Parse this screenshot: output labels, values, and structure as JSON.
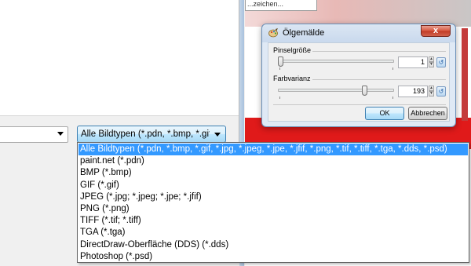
{
  "file_dialog": {
    "filename_value": "",
    "filetype_selected": "Alle Bildtypen (*.pdn, *.bmp, *.gif, *.jpg, *.jpeg, *.jpe, *.jfif, *.png, *.tif, *.tiff, *.tga, *.dds, *.psd)",
    "filetype_options": [
      "Alle Bildtypen (*.pdn, *.bmp, *.gif, *.jpg, *.jpeg, *.jpe, *.jfif, *.png, *.tif, *.tiff, *.tga, *.dds, *.psd)",
      "paint.net (*.pdn)",
      "BMP (*.bmp)",
      "GIF (*.gif)",
      "JPEG (*.jpg; *.jpeg; *.jpe; *.jfif)",
      "PNG (*.png)",
      "TIFF (*.tif; *.tiff)",
      "TGA (*.tga)",
      "DirectDraw-Oberfläche (DDS) (*.dds)",
      "Photoshop (*.psd)"
    ],
    "selected_index": 0
  },
  "background_window": {
    "caption_text": "...zeichen..."
  },
  "oil_dialog": {
    "title": "Ölgemälde",
    "close_label": "x",
    "brush_size": {
      "label": "Pinselgröße",
      "value": "1",
      "level": 0.0
    },
    "coarseness": {
      "label": "Farbvarianz",
      "value": "193",
      "level": 0.76
    },
    "ok_label": "OK",
    "cancel_label": "Abbrechen",
    "reset_icon": "reset-icon"
  },
  "colors": {
    "selection": "#3399ff",
    "canvas_red": "#e01a1a",
    "dialog_frame": "#dfe9f5",
    "close_button": "#c13a25"
  }
}
